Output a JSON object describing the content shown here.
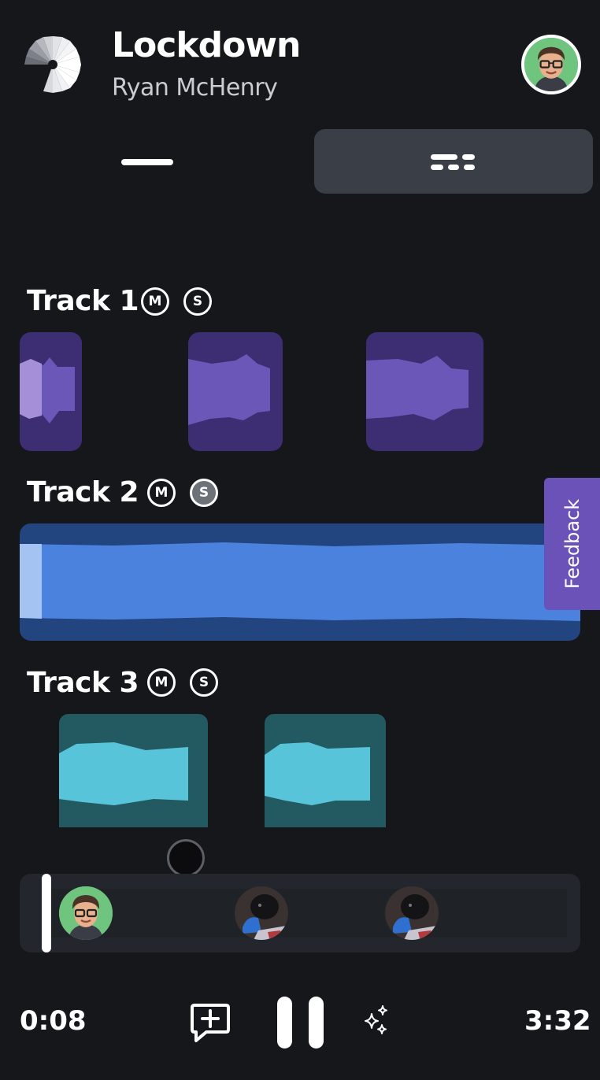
{
  "header": {
    "title": "Lockdown",
    "artist": "Ryan McHenry"
  },
  "view_toggle": {
    "options": [
      "single-view",
      "multi-view"
    ],
    "selected": "multi-view"
  },
  "tracks": [
    {
      "name": "Track 1",
      "mute_label": "M",
      "solo_label": "S",
      "solo_active": false,
      "color": "#6b57b8"
    },
    {
      "name": "Track 2",
      "mute_label": "M",
      "solo_label": "S",
      "solo_active": true,
      "color": "#4a82dd"
    },
    {
      "name": "Track 3",
      "mute_label": "M",
      "solo_label": "S",
      "solo_active": false,
      "color": "#58c4da"
    }
  ],
  "feedback": {
    "label": "Feedback"
  },
  "transport": {
    "elapsed": "0:08",
    "total": "3:32",
    "progress_fraction": 0.038
  },
  "colors": {
    "background": "#16171b",
    "accent": "#6b52b8",
    "toggle_active": "#3a3f47"
  },
  "icons": [
    "app-logo-icon",
    "comment-add-icon",
    "pause-icon",
    "sparkle-icon"
  ]
}
